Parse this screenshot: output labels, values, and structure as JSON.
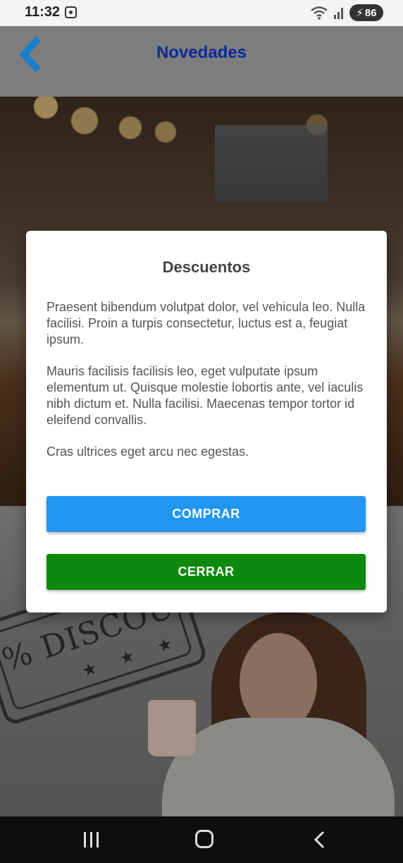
{
  "status_bar": {
    "time": "11:32",
    "battery": "86",
    "icons": [
      "media-icon",
      "wifi-icon",
      "signal-icon",
      "battery-charging-icon"
    ]
  },
  "header": {
    "title": "Novedades",
    "back_icon": "chevron-left-icon"
  },
  "banners": {
    "cafe": "cafe-photo",
    "discount": {
      "stamp_text": "% DISCOU"
    }
  },
  "dialog": {
    "title": "Descuentos",
    "paragraphs": [
      "Praesent bibendum volutpat dolor, vel vehicula leo. Nulla facilisi. Proin a turpis consectetur, luctus est a, feugiat ipsum.",
      "Mauris facilisis facilisis leo, eget vulputate ipsum elementum ut. Quisque molestie lobortis ante, vel iaculis nibh dictum et. Nulla facilisi. Maecenas tempor tortor id eleifend convallis.",
      "Cras ultrices eget arcu nec egestas."
    ],
    "buy_label": "COMPRAR",
    "close_label": "CERRAR"
  },
  "nav_bar": {
    "icons": [
      "recent-apps-icon",
      "home-icon",
      "back-icon"
    ]
  },
  "colors": {
    "header_title": "#0a2a9a",
    "back_chevron": "#1a7fc8",
    "buy_button": "#2196f3",
    "close_button": "#0d8a0d",
    "dialog_title": "#444444",
    "dialog_text": "#555555"
  }
}
